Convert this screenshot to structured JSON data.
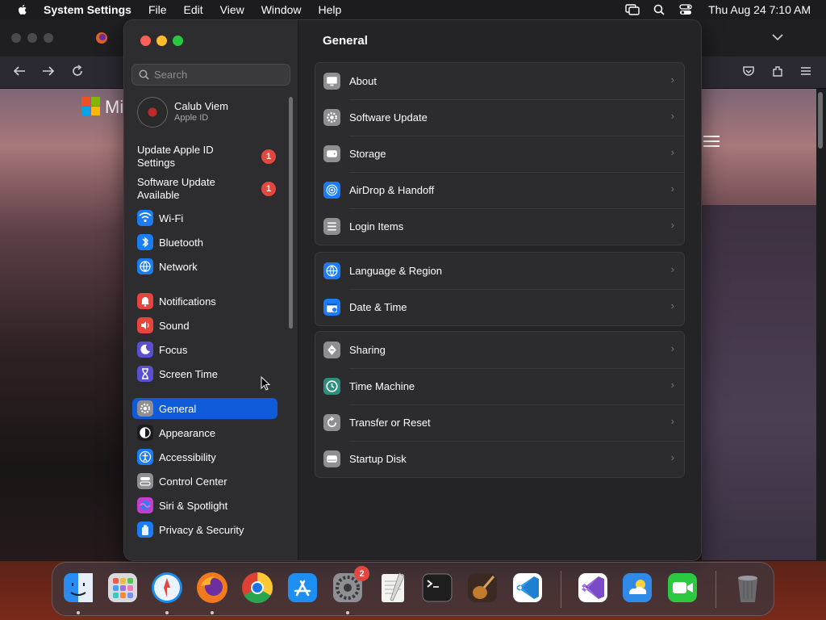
{
  "menubar": {
    "app_name": "System Settings",
    "menus": [
      "File",
      "Edit",
      "View",
      "Window",
      "Help"
    ],
    "clock": "Thu Aug 24  7:10 AM"
  },
  "browser": {
    "partial_text": "Mi"
  },
  "search": {
    "placeholder": "Search"
  },
  "profile": {
    "name": "Calub Viem",
    "subtitle": "Apple ID"
  },
  "notices": [
    {
      "label": "Update Apple ID Settings",
      "badge": "1"
    },
    {
      "label": "Software Update Available",
      "badge": "1"
    }
  ],
  "sidebar": {
    "items": [
      {
        "label": "Wi-Fi",
        "icon": "wifi-icon",
        "color": "#1b7cf5"
      },
      {
        "label": "Bluetooth",
        "icon": "bluetooth-icon",
        "color": "#1b7cf5"
      },
      {
        "label": "Network",
        "icon": "globe-icon",
        "color": "#1b7cf5"
      },
      {
        "label": "Notifications",
        "icon": "bell-icon",
        "color": "#e5453d"
      },
      {
        "label": "Sound",
        "icon": "speaker-icon",
        "color": "#e5453d"
      },
      {
        "label": "Focus",
        "icon": "moon-icon",
        "color": "#5b4fd0"
      },
      {
        "label": "Screen Time",
        "icon": "hourglass-icon",
        "color": "#5b4fd0"
      },
      {
        "label": "General",
        "icon": "gear-icon",
        "color": "#8e8e93",
        "active": true
      },
      {
        "label": "Appearance",
        "icon": "appearance-icon",
        "color": "#1c1c1e"
      },
      {
        "label": "Accessibility",
        "icon": "accessibility-icon",
        "color": "#1b7cf5"
      },
      {
        "label": "Control Center",
        "icon": "control-center-icon",
        "color": "#8e8e93"
      },
      {
        "label": "Siri & Spotlight",
        "icon": "siri-icon",
        "color": "#c03fd0"
      },
      {
        "label": "Privacy & Security",
        "icon": "hand-icon",
        "color": "#1b7cf5"
      }
    ]
  },
  "main": {
    "title": "General",
    "groups": [
      [
        {
          "label": "About",
          "icon": "about-icon",
          "color": "#8e8e93"
        },
        {
          "label": "Software Update",
          "icon": "gear-icon",
          "color": "#8e8e93"
        },
        {
          "label": "Storage",
          "icon": "storage-icon",
          "color": "#8e8e93"
        },
        {
          "label": "AirDrop & Handoff",
          "icon": "airdrop-icon",
          "color": "#1b7cf5"
        },
        {
          "label": "Login Items",
          "icon": "list-icon",
          "color": "#8e8e93"
        }
      ],
      [
        {
          "label": "Language & Region",
          "icon": "globe-icon",
          "color": "#1b7cf5"
        },
        {
          "label": "Date & Time",
          "icon": "calendar-icon",
          "color": "#1b7cf5"
        }
      ],
      [
        {
          "label": "Sharing",
          "icon": "sharing-icon",
          "color": "#8e8e93"
        },
        {
          "label": "Time Machine",
          "icon": "time-machine-icon",
          "color": "#2d8f7b"
        },
        {
          "label": "Transfer or Reset",
          "icon": "reset-icon",
          "color": "#8e8e93"
        },
        {
          "label": "Startup Disk",
          "icon": "disk-icon",
          "color": "#8e8e93"
        }
      ]
    ]
  },
  "dock": {
    "apps": [
      {
        "name": "finder-icon",
        "color": "#2a8bf2",
        "running": true
      },
      {
        "name": "launchpad-icon",
        "color": "#d9d9de",
        "running": false
      },
      {
        "name": "safari-icon",
        "color": "#1a8cf0",
        "running": true
      },
      {
        "name": "firefox-icon",
        "color": "#f07a1d",
        "running": true
      },
      {
        "name": "chrome-icon",
        "color": "#ffffff",
        "running": false
      },
      {
        "name": "app-store-icon",
        "color": "#1d8ef2",
        "running": false
      },
      {
        "name": "system-settings-icon",
        "color": "#8e8e93",
        "running": true,
        "badge": "2"
      },
      {
        "name": "textedit-icon",
        "color": "#f3f3f0",
        "running": false
      },
      {
        "name": "terminal-icon",
        "color": "#1e1e1e",
        "running": false
      },
      {
        "name": "garageband-icon",
        "color": "#3a2a22",
        "running": false
      },
      {
        "name": "vscode-icon",
        "color": "#ffffff",
        "running": false
      },
      {
        "name": "visual-studio-icon",
        "color": "#ffffff",
        "running": false
      },
      {
        "name": "weather-icon",
        "color": "#2f8ae8",
        "running": false
      },
      {
        "name": "facetime-icon",
        "color": "#2bc840",
        "running": false
      },
      {
        "name": "trash-icon",
        "color": "#6a6a6d",
        "running": false
      }
    ]
  }
}
